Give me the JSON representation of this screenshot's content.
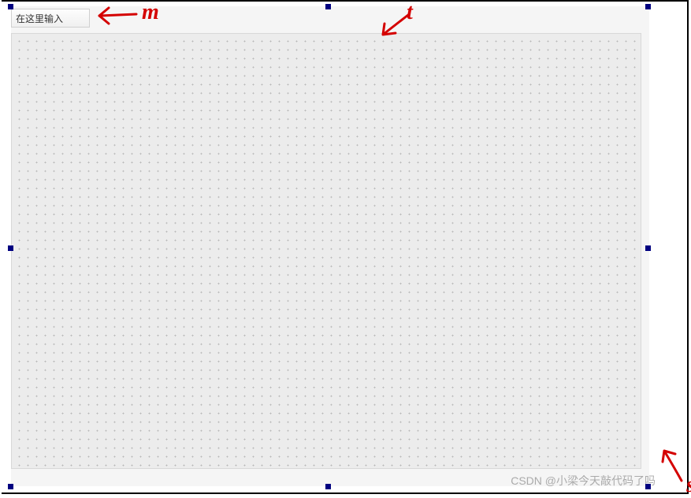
{
  "designer": {
    "input_label": "在这里输入"
  },
  "annotations": {
    "m": "m",
    "t": "t",
    "s": "s"
  },
  "watermark": "CSDN @小梁今天敲代码了吗"
}
